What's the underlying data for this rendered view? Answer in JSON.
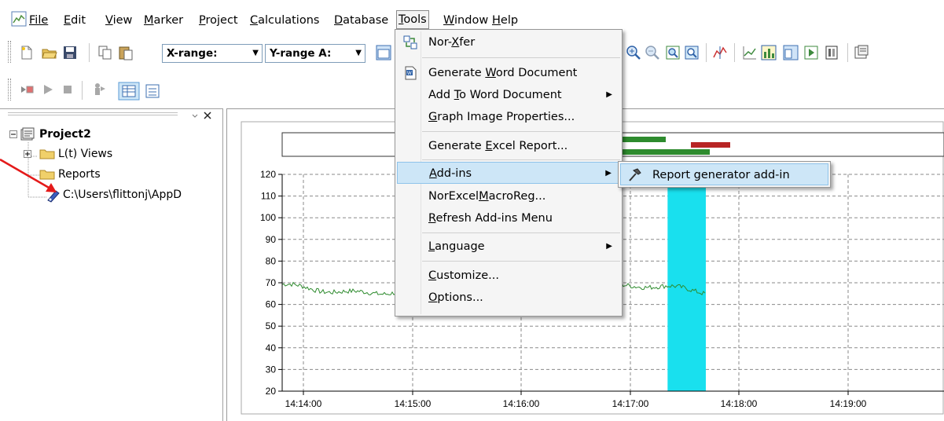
{
  "menubar": {
    "items": [
      "File",
      "Edit",
      "View",
      "Marker",
      "Project",
      "Calculations",
      "Database",
      "Tools",
      "Window",
      "Help"
    ]
  },
  "toolbar": {
    "xrange_label": "X-range:",
    "yrange_label": "Y-range A:"
  },
  "tree": {
    "project": "Project2",
    "items": [
      "L(t) Views",
      "Reports",
      "C:\\Users\\flittonj\\AppD"
    ]
  },
  "tools_menu": {
    "items": [
      "Nor-Xfer",
      "Generate Word Document",
      "Add To Word Document",
      "Graph Image Properties...",
      "Generate Excel Report...",
      "Add-ins",
      "NorExcelMacroReg...",
      "Refresh Add-ins Menu",
      "Language",
      "Customize...",
      "Options..."
    ],
    "highlighted": "Add-ins"
  },
  "addins_submenu": {
    "items": [
      "Report generator add-in"
    ]
  },
  "chart_data": {
    "type": "line",
    "y_ticks": [
      "120",
      "110",
      "100",
      "90",
      "80",
      "70",
      "60",
      "50",
      "40",
      "30",
      "20"
    ],
    "x_ticks": [
      "14:14:00",
      "14:15:00",
      "14:16:00",
      "14:17:00",
      "14:18:00",
      "14:19:00"
    ],
    "ylim": [
      20,
      120
    ],
    "grid": true,
    "series": [
      {
        "color": "#2e8b2e",
        "approx_level": 67
      }
    ],
    "highlight_band": {
      "start": "14:17:20",
      "end": "14:17:41",
      "color": "#19e0ee"
    }
  },
  "colors": {
    "menu_highlight": "#cde6f7",
    "band": "#19e0ee",
    "series": "#2e8b2e",
    "red_arrow": "#e41a1a"
  }
}
